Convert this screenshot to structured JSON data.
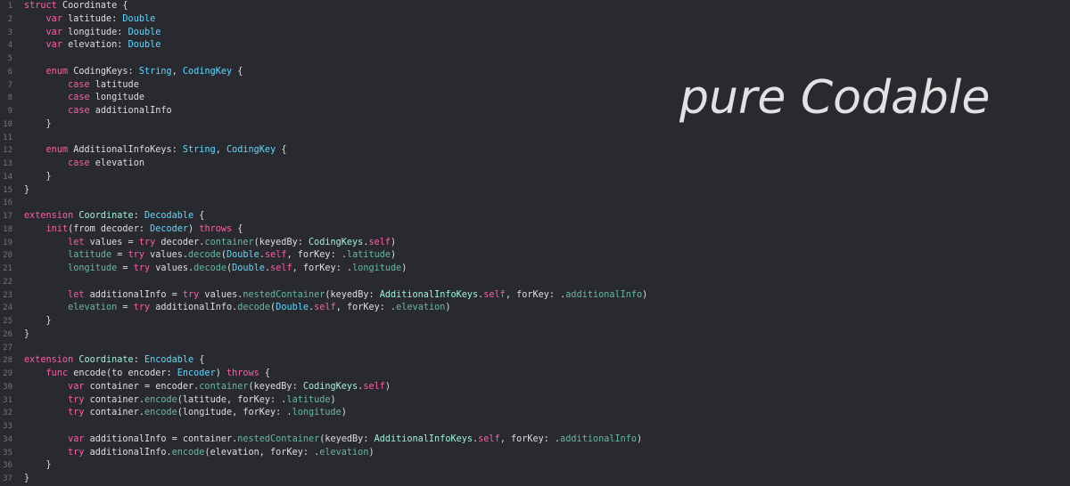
{
  "overlay": {
    "title": "pure Codable"
  },
  "colors": {
    "background": "#292a30",
    "line_numbers": "#747478",
    "keyword": "#fc5fa3",
    "type": "#5dd8ff",
    "user_type": "#9ef1dd",
    "function": "#67b7a4",
    "plain": "#dfdfe0",
    "member": "#a167e6"
  },
  "code": {
    "lines": [
      {
        "n": "1",
        "tokens": [
          {
            "t": "struct",
            "c": "kw"
          },
          {
            "t": " Coordinate {",
            "c": "decl"
          }
        ]
      },
      {
        "n": "2",
        "tokens": [
          {
            "t": "    ",
            "c": "plain"
          },
          {
            "t": "var",
            "c": "kw"
          },
          {
            "t": " latitude: ",
            "c": "plain"
          },
          {
            "t": "Double",
            "c": "type"
          }
        ]
      },
      {
        "n": "3",
        "tokens": [
          {
            "t": "    ",
            "c": "plain"
          },
          {
            "t": "var",
            "c": "kw"
          },
          {
            "t": " longitude: ",
            "c": "plain"
          },
          {
            "t": "Double",
            "c": "type"
          }
        ]
      },
      {
        "n": "4",
        "tokens": [
          {
            "t": "    ",
            "c": "plain"
          },
          {
            "t": "var",
            "c": "kw"
          },
          {
            "t": " elevation: ",
            "c": "plain"
          },
          {
            "t": "Double",
            "c": "type"
          }
        ]
      },
      {
        "n": "5",
        "tokens": []
      },
      {
        "n": "6",
        "tokens": [
          {
            "t": "    ",
            "c": "plain"
          },
          {
            "t": "enum",
            "c": "kw"
          },
          {
            "t": " CodingKeys: ",
            "c": "plain"
          },
          {
            "t": "String",
            "c": "type"
          },
          {
            "t": ", ",
            "c": "plain"
          },
          {
            "t": "CodingKey",
            "c": "type"
          },
          {
            "t": " {",
            "c": "plain"
          }
        ]
      },
      {
        "n": "7",
        "tokens": [
          {
            "t": "        ",
            "c": "plain"
          },
          {
            "t": "case",
            "c": "kw"
          },
          {
            "t": " latitude",
            "c": "plain"
          }
        ]
      },
      {
        "n": "8",
        "tokens": [
          {
            "t": "        ",
            "c": "plain"
          },
          {
            "t": "case",
            "c": "kw"
          },
          {
            "t": " longitude",
            "c": "plain"
          }
        ]
      },
      {
        "n": "9",
        "tokens": [
          {
            "t": "        ",
            "c": "plain"
          },
          {
            "t": "case",
            "c": "kw"
          },
          {
            "t": " additionalInfo",
            "c": "plain"
          }
        ]
      },
      {
        "n": "10",
        "tokens": [
          {
            "t": "    }",
            "c": "plain"
          }
        ]
      },
      {
        "n": "11",
        "tokens": []
      },
      {
        "n": "12",
        "tokens": [
          {
            "t": "    ",
            "c": "plain"
          },
          {
            "t": "enum",
            "c": "kw"
          },
          {
            "t": " AdditionalInfoKeys: ",
            "c": "plain"
          },
          {
            "t": "String",
            "c": "type"
          },
          {
            "t": ", ",
            "c": "plain"
          },
          {
            "t": "CodingKey",
            "c": "type"
          },
          {
            "t": " {",
            "c": "plain"
          }
        ]
      },
      {
        "n": "13",
        "tokens": [
          {
            "t": "        ",
            "c": "plain"
          },
          {
            "t": "case",
            "c": "kw"
          },
          {
            "t": " elevation",
            "c": "plain"
          }
        ]
      },
      {
        "n": "14",
        "tokens": [
          {
            "t": "    }",
            "c": "plain"
          }
        ]
      },
      {
        "n": "15",
        "tokens": [
          {
            "t": "}",
            "c": "plain"
          }
        ]
      },
      {
        "n": "16",
        "tokens": []
      },
      {
        "n": "17",
        "tokens": [
          {
            "t": "extension",
            "c": "kw"
          },
          {
            "t": " ",
            "c": "plain"
          },
          {
            "t": "Coordinate",
            "c": "usertype"
          },
          {
            "t": ": ",
            "c": "plain"
          },
          {
            "t": "Decodable",
            "c": "type"
          },
          {
            "t": " {",
            "c": "plain"
          }
        ]
      },
      {
        "n": "18",
        "tokens": [
          {
            "t": "    ",
            "c": "plain"
          },
          {
            "t": "init",
            "c": "kw"
          },
          {
            "t": "(from decoder: ",
            "c": "plain"
          },
          {
            "t": "Decoder",
            "c": "type"
          },
          {
            "t": ") ",
            "c": "plain"
          },
          {
            "t": "throws",
            "c": "kw"
          },
          {
            "t": " {",
            "c": "plain"
          }
        ]
      },
      {
        "n": "19",
        "tokens": [
          {
            "t": "        ",
            "c": "plain"
          },
          {
            "t": "let",
            "c": "kw"
          },
          {
            "t": " values = ",
            "c": "plain"
          },
          {
            "t": "try",
            "c": "kw"
          },
          {
            "t": " decoder.",
            "c": "plain"
          },
          {
            "t": "container",
            "c": "fn"
          },
          {
            "t": "(keyedBy: ",
            "c": "plain"
          },
          {
            "t": "CodingKeys",
            "c": "usertype"
          },
          {
            "t": ".",
            "c": "plain"
          },
          {
            "t": "self",
            "c": "kw"
          },
          {
            "t": ")",
            "c": "plain"
          }
        ]
      },
      {
        "n": "20",
        "tokens": [
          {
            "t": "        ",
            "c": "plain"
          },
          {
            "t": "latitude",
            "c": "prop"
          },
          {
            "t": " = ",
            "c": "plain"
          },
          {
            "t": "try",
            "c": "kw"
          },
          {
            "t": " values.",
            "c": "plain"
          },
          {
            "t": "decode",
            "c": "fn"
          },
          {
            "t": "(",
            "c": "plain"
          },
          {
            "t": "Double",
            "c": "type"
          },
          {
            "t": ".",
            "c": "plain"
          },
          {
            "t": "self",
            "c": "kw"
          },
          {
            "t": ", forKey: .",
            "c": "plain"
          },
          {
            "t": "latitude",
            "c": "fn"
          },
          {
            "t": ")",
            "c": "plain"
          }
        ]
      },
      {
        "n": "21",
        "tokens": [
          {
            "t": "        ",
            "c": "plain"
          },
          {
            "t": "longitude",
            "c": "prop"
          },
          {
            "t": " = ",
            "c": "plain"
          },
          {
            "t": "try",
            "c": "kw"
          },
          {
            "t": " values.",
            "c": "plain"
          },
          {
            "t": "decode",
            "c": "fn"
          },
          {
            "t": "(",
            "c": "plain"
          },
          {
            "t": "Double",
            "c": "type"
          },
          {
            "t": ".",
            "c": "plain"
          },
          {
            "t": "self",
            "c": "kw"
          },
          {
            "t": ", forKey: .",
            "c": "plain"
          },
          {
            "t": "longitude",
            "c": "fn"
          },
          {
            "t": ")",
            "c": "plain"
          }
        ]
      },
      {
        "n": "22",
        "tokens": []
      },
      {
        "n": "23",
        "tokens": [
          {
            "t": "        ",
            "c": "plain"
          },
          {
            "t": "let",
            "c": "kw"
          },
          {
            "t": " additionalInfo = ",
            "c": "plain"
          },
          {
            "t": "try",
            "c": "kw"
          },
          {
            "t": " values.",
            "c": "plain"
          },
          {
            "t": "nestedContainer",
            "c": "fn"
          },
          {
            "t": "(keyedBy: ",
            "c": "plain"
          },
          {
            "t": "AdditionalInfoKeys",
            "c": "usertype"
          },
          {
            "t": ".",
            "c": "plain"
          },
          {
            "t": "self",
            "c": "kw"
          },
          {
            "t": ", forKey: .",
            "c": "plain"
          },
          {
            "t": "additionalInfo",
            "c": "fn"
          },
          {
            "t": ")",
            "c": "plain"
          }
        ]
      },
      {
        "n": "24",
        "tokens": [
          {
            "t": "        ",
            "c": "plain"
          },
          {
            "t": "elevation",
            "c": "prop"
          },
          {
            "t": " = ",
            "c": "plain"
          },
          {
            "t": "try",
            "c": "kw"
          },
          {
            "t": " additionalInfo.",
            "c": "plain"
          },
          {
            "t": "decode",
            "c": "fn"
          },
          {
            "t": "(",
            "c": "plain"
          },
          {
            "t": "Double",
            "c": "type"
          },
          {
            "t": ".",
            "c": "plain"
          },
          {
            "t": "self",
            "c": "kw"
          },
          {
            "t": ", forKey: .",
            "c": "plain"
          },
          {
            "t": "elevation",
            "c": "fn"
          },
          {
            "t": ")",
            "c": "plain"
          }
        ]
      },
      {
        "n": "25",
        "tokens": [
          {
            "t": "    }",
            "c": "plain"
          }
        ]
      },
      {
        "n": "26",
        "tokens": [
          {
            "t": "}",
            "c": "plain"
          }
        ]
      },
      {
        "n": "27",
        "tokens": []
      },
      {
        "n": "28",
        "tokens": [
          {
            "t": "extension",
            "c": "kw"
          },
          {
            "t": " ",
            "c": "plain"
          },
          {
            "t": "Coordinate",
            "c": "usertype"
          },
          {
            "t": ": ",
            "c": "plain"
          },
          {
            "t": "Encodable",
            "c": "type"
          },
          {
            "t": " {",
            "c": "plain"
          }
        ]
      },
      {
        "n": "29",
        "tokens": [
          {
            "t": "    ",
            "c": "plain"
          },
          {
            "t": "func",
            "c": "kw"
          },
          {
            "t": " encode(to encoder: ",
            "c": "plain"
          },
          {
            "t": "Encoder",
            "c": "type"
          },
          {
            "t": ") ",
            "c": "plain"
          },
          {
            "t": "throws",
            "c": "kw"
          },
          {
            "t": " {",
            "c": "plain"
          }
        ]
      },
      {
        "n": "30",
        "tokens": [
          {
            "t": "        ",
            "c": "plain"
          },
          {
            "t": "var",
            "c": "kw"
          },
          {
            "t": " container = encoder.",
            "c": "plain"
          },
          {
            "t": "container",
            "c": "fn"
          },
          {
            "t": "(keyedBy: ",
            "c": "plain"
          },
          {
            "t": "CodingKeys",
            "c": "usertype"
          },
          {
            "t": ".",
            "c": "plain"
          },
          {
            "t": "self",
            "c": "kw"
          },
          {
            "t": ")",
            "c": "plain"
          }
        ]
      },
      {
        "n": "31",
        "tokens": [
          {
            "t": "        ",
            "c": "plain"
          },
          {
            "t": "try",
            "c": "kw"
          },
          {
            "t": " container.",
            "c": "plain"
          },
          {
            "t": "encode",
            "c": "fn"
          },
          {
            "t": "(latitude, forKey: .",
            "c": "plain"
          },
          {
            "t": "latitude",
            "c": "fn"
          },
          {
            "t": ")",
            "c": "plain"
          }
        ]
      },
      {
        "n": "32",
        "tokens": [
          {
            "t": "        ",
            "c": "plain"
          },
          {
            "t": "try",
            "c": "kw"
          },
          {
            "t": " container.",
            "c": "plain"
          },
          {
            "t": "encode",
            "c": "fn"
          },
          {
            "t": "(longitude, forKey: .",
            "c": "plain"
          },
          {
            "t": "longitude",
            "c": "fn"
          },
          {
            "t": ")",
            "c": "plain"
          }
        ]
      },
      {
        "n": "33",
        "tokens": []
      },
      {
        "n": "34",
        "tokens": [
          {
            "t": "        ",
            "c": "plain"
          },
          {
            "t": "var",
            "c": "kw"
          },
          {
            "t": " additionalInfo = container.",
            "c": "plain"
          },
          {
            "t": "nestedContainer",
            "c": "fn"
          },
          {
            "t": "(keyedBy: ",
            "c": "plain"
          },
          {
            "t": "AdditionalInfoKeys",
            "c": "usertype"
          },
          {
            "t": ".",
            "c": "plain"
          },
          {
            "t": "self",
            "c": "kw"
          },
          {
            "t": ", forKey: .",
            "c": "plain"
          },
          {
            "t": "additionalInfo",
            "c": "fn"
          },
          {
            "t": ")",
            "c": "plain"
          }
        ]
      },
      {
        "n": "35",
        "tokens": [
          {
            "t": "        ",
            "c": "plain"
          },
          {
            "t": "try",
            "c": "kw"
          },
          {
            "t": " additionalInfo.",
            "c": "plain"
          },
          {
            "t": "encode",
            "c": "fn"
          },
          {
            "t": "(elevation, forKey: .",
            "c": "plain"
          },
          {
            "t": "elevation",
            "c": "fn"
          },
          {
            "t": ")",
            "c": "plain"
          }
        ]
      },
      {
        "n": "36",
        "tokens": [
          {
            "t": "    }",
            "c": "plain"
          }
        ]
      },
      {
        "n": "37",
        "tokens": [
          {
            "t": "}",
            "c": "plain"
          }
        ]
      }
    ]
  }
}
